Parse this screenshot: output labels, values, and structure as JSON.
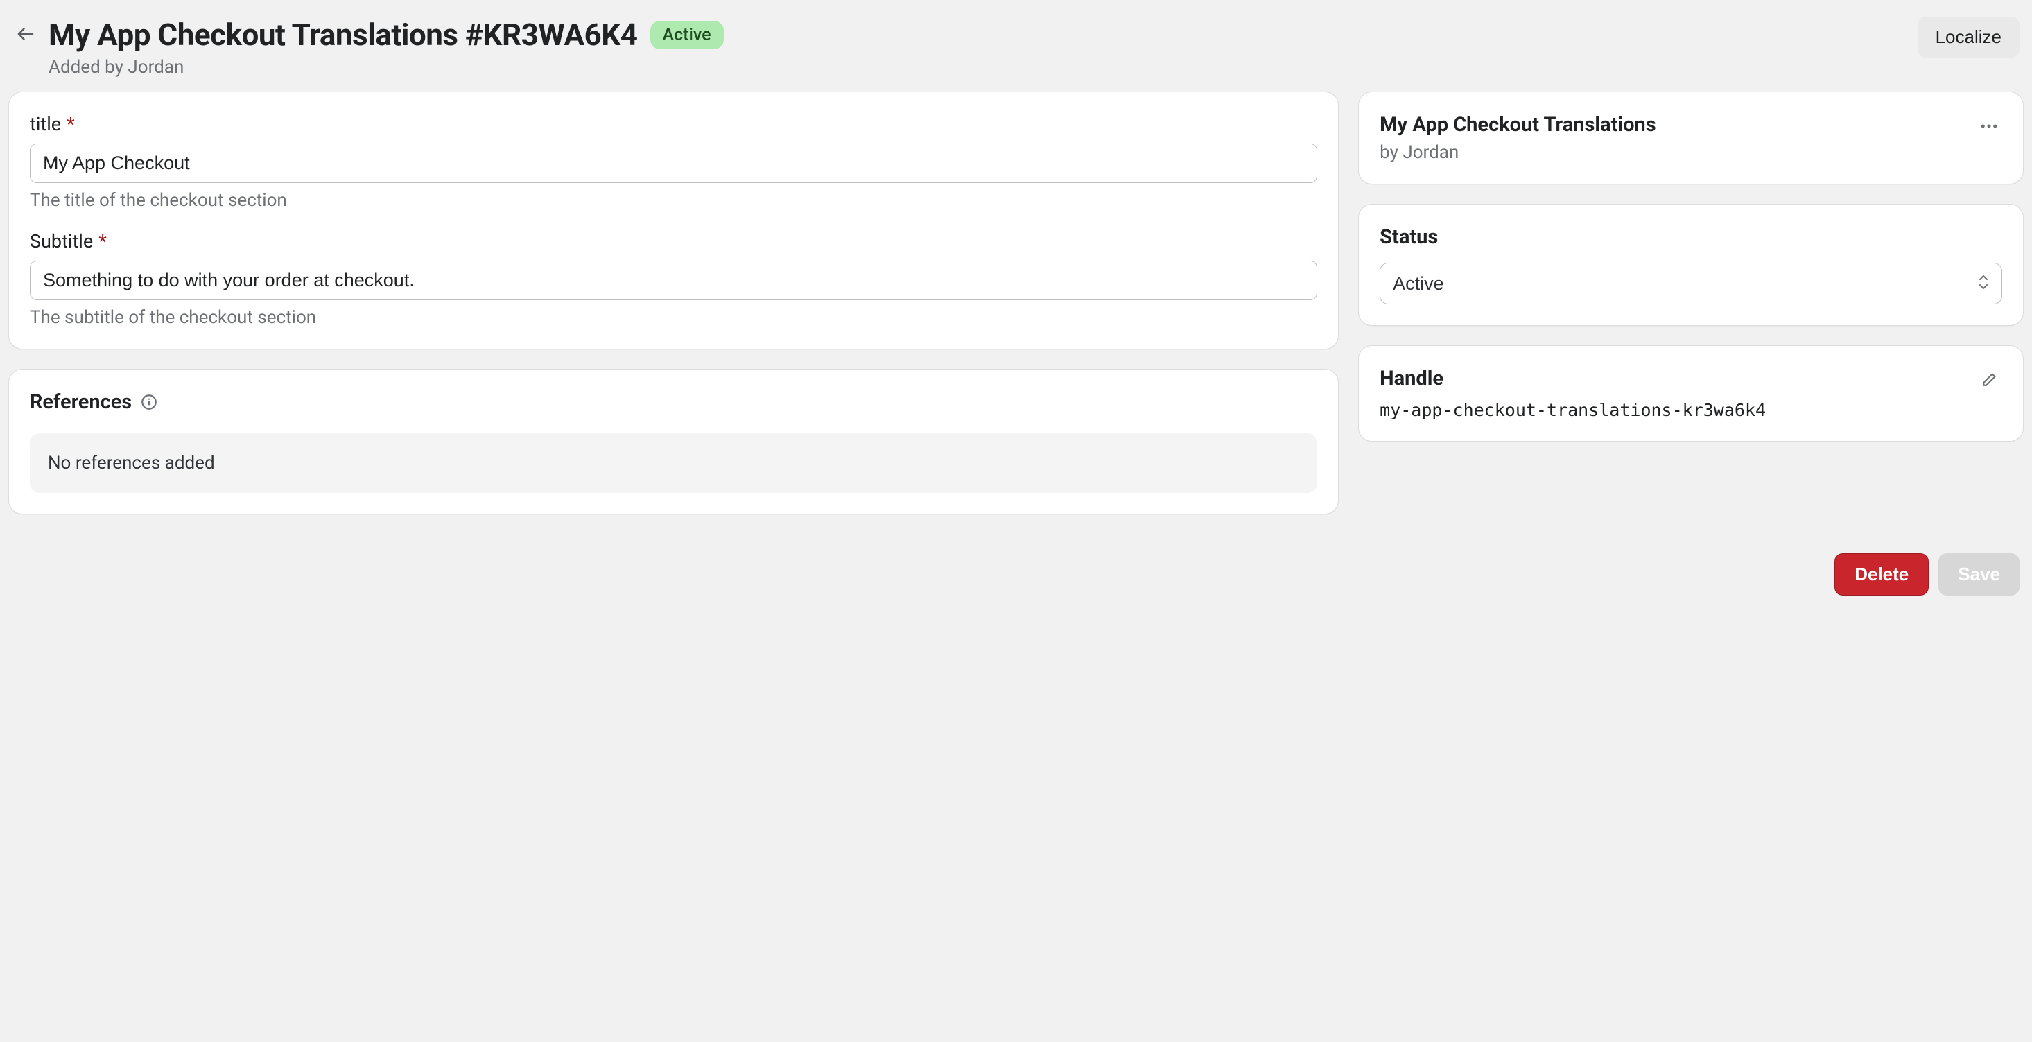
{
  "header": {
    "title": "My App Checkout Translations #KR3WA6K4",
    "status_badge": "Active",
    "subtitle": "Added by Jordan",
    "localize_label": "Localize"
  },
  "fields": {
    "title": {
      "label": "title",
      "value": "My App Checkout",
      "help": "The title of the checkout section"
    },
    "subtitle": {
      "label": "Subtitle",
      "value": "Something to do with your order at checkout.",
      "help": "The subtitle of the checkout section"
    }
  },
  "references": {
    "heading": "References",
    "empty_text": "No references added"
  },
  "sidebar": {
    "summary": {
      "title": "My App Checkout Translations",
      "byline": "by Jordan"
    },
    "status": {
      "heading": "Status",
      "selected": "Active"
    },
    "handle": {
      "heading": "Handle",
      "value": "my-app-checkout-translations-kr3wa6k4"
    }
  },
  "footer": {
    "delete_label": "Delete",
    "save_label": "Save"
  }
}
